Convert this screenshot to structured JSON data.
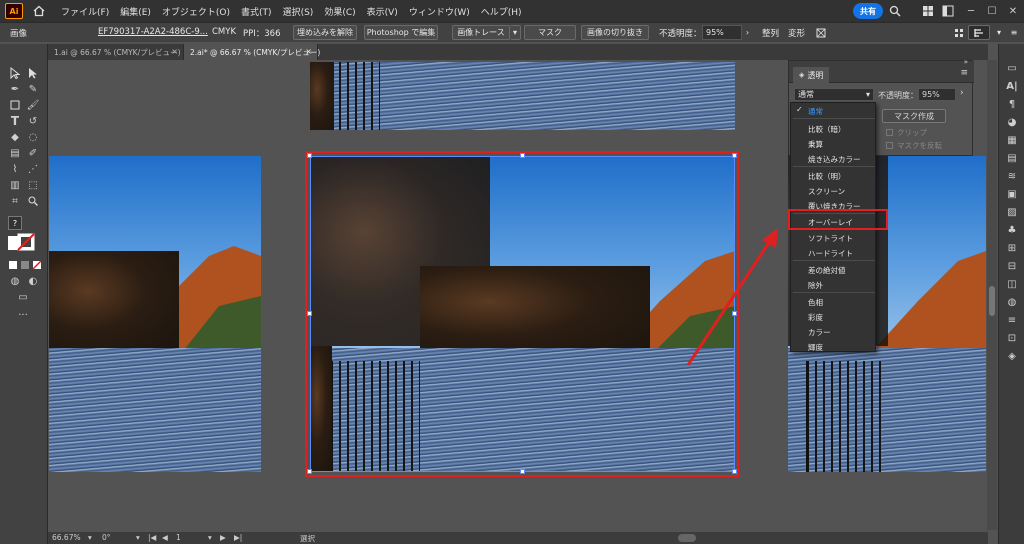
{
  "menubar": {
    "items": [
      "ファイル(F)",
      "編集(E)",
      "オブジェクト(O)",
      "書式(T)",
      "選択(S)",
      "効果(C)",
      "表示(V)",
      "ウィンドウ(W)",
      "ヘルプ(H)"
    ],
    "share_label": "共有"
  },
  "controlbar": {
    "object_type": "画像",
    "filename": "EF790317-A2A2-486C-9...",
    "color_mode": "CMYK",
    "ppi": "PPI：366",
    "embed_release": "埋め込みを解除",
    "photoshop_edit": "Photoshop で編集",
    "image_trace": "画像トレース",
    "mask": "マスク",
    "crop": "画像の切り抜き",
    "opacity_label": "不透明度：",
    "opacity_value": "95%",
    "align": "整列",
    "transform": "変形"
  },
  "tabs": [
    {
      "label": "1.ai @ 66.67 % (CMYK/プレビュー)"
    },
    {
      "label": "2.ai* @ 66.67 % (CMYK/プレビュー)"
    }
  ],
  "transparency_panel": {
    "title": "透明",
    "blend_mode": "通常",
    "opacity_label": "不透明度：",
    "opacity_value": "95%",
    "make_mask": "マスク作成",
    "clip": "クリップ",
    "invert_mask": "マスクを反転"
  },
  "blend_menu": {
    "items": [
      {
        "label": "通常",
        "selected": true
      },
      {
        "label": "比較（暗）"
      },
      {
        "label": "乗算"
      },
      {
        "label": "焼き込みカラー"
      },
      {
        "label": "比較（明）"
      },
      {
        "label": "スクリーン"
      },
      {
        "label": "覆い焼きカラー"
      },
      {
        "label": "オーバーレイ"
      },
      {
        "label": "ソフトライト"
      },
      {
        "label": "ハードライト"
      },
      {
        "label": "差の絶対値"
      },
      {
        "label": "除外"
      },
      {
        "label": "色相"
      },
      {
        "label": "彩度"
      },
      {
        "label": "カラー"
      },
      {
        "label": "輝度"
      }
    ]
  },
  "statusbar": {
    "zoom": "66.67%",
    "rotation": "0°",
    "artboard": "1",
    "tool": "選択"
  },
  "colors": {
    "accent_blue": "#1473e6",
    "highlight_red": "#e02020",
    "selection_blue": "#5b8cff"
  }
}
